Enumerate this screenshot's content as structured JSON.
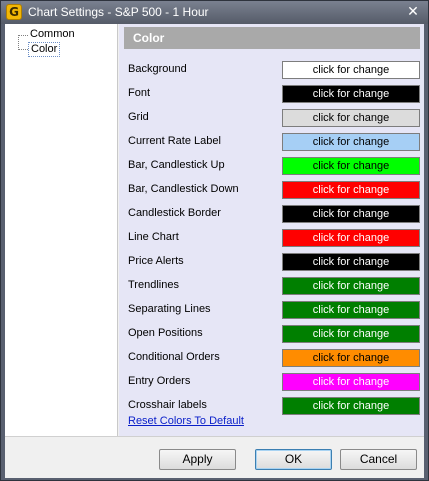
{
  "window": {
    "title": "Chart Settings - S&P 500 - 1 Hour",
    "app_icon_letter": "G",
    "close_glyph": "✕"
  },
  "tree": {
    "items": [
      {
        "label": "Common"
      },
      {
        "label": "Color",
        "selected": true
      }
    ]
  },
  "panel": {
    "header": "Color",
    "rows": [
      {
        "label": "Background",
        "button": "click for change",
        "bg": "#ffffff",
        "fg": "#000000"
      },
      {
        "label": "Font",
        "button": "click for change",
        "bg": "#000000",
        "fg": "#ffffff"
      },
      {
        "label": "Grid",
        "button": "click for change",
        "bg": "#dcdcdc",
        "fg": "#000000"
      },
      {
        "label": "Current Rate Label",
        "button": "click for change",
        "bg": "#a6cff5",
        "fg": "#000000"
      },
      {
        "label": "Bar, Candlestick Up",
        "button": "click for change",
        "bg": "#00ff00",
        "fg": "#000000"
      },
      {
        "label": "Bar, Candlestick Down",
        "button": "click for change",
        "bg": "#ff0000",
        "fg": "#ffffff"
      },
      {
        "label": "Candlestick Border",
        "button": "click for change",
        "bg": "#000000",
        "fg": "#ffffff"
      },
      {
        "label": "Line Chart",
        "button": "click for change",
        "bg": "#ff0000",
        "fg": "#ffffff"
      },
      {
        "label": "Price Alerts",
        "button": "click for change",
        "bg": "#000000",
        "fg": "#ffffff"
      },
      {
        "label": "Trendlines",
        "button": "click for change",
        "bg": "#007f00",
        "fg": "#ffffff"
      },
      {
        "label": "Separating Lines",
        "button": "click for change",
        "bg": "#007f00",
        "fg": "#ffffff"
      },
      {
        "label": "Open Positions",
        "button": "click for change",
        "bg": "#007f00",
        "fg": "#ffffff"
      },
      {
        "label": "Conditional Orders",
        "button": "click for change",
        "bg": "#ff8c00",
        "fg": "#000000"
      },
      {
        "label": "Entry Orders",
        "button": "click for change",
        "bg": "#ff00ff",
        "fg": "#ffffff"
      },
      {
        "label": "Crosshair labels",
        "button": "click for change",
        "bg": "#007f00",
        "fg": "#ffffff"
      }
    ],
    "reset_link": "Reset Colors To Default"
  },
  "buttons": {
    "apply": "Apply",
    "ok": "OK",
    "cancel": "Cancel"
  }
}
